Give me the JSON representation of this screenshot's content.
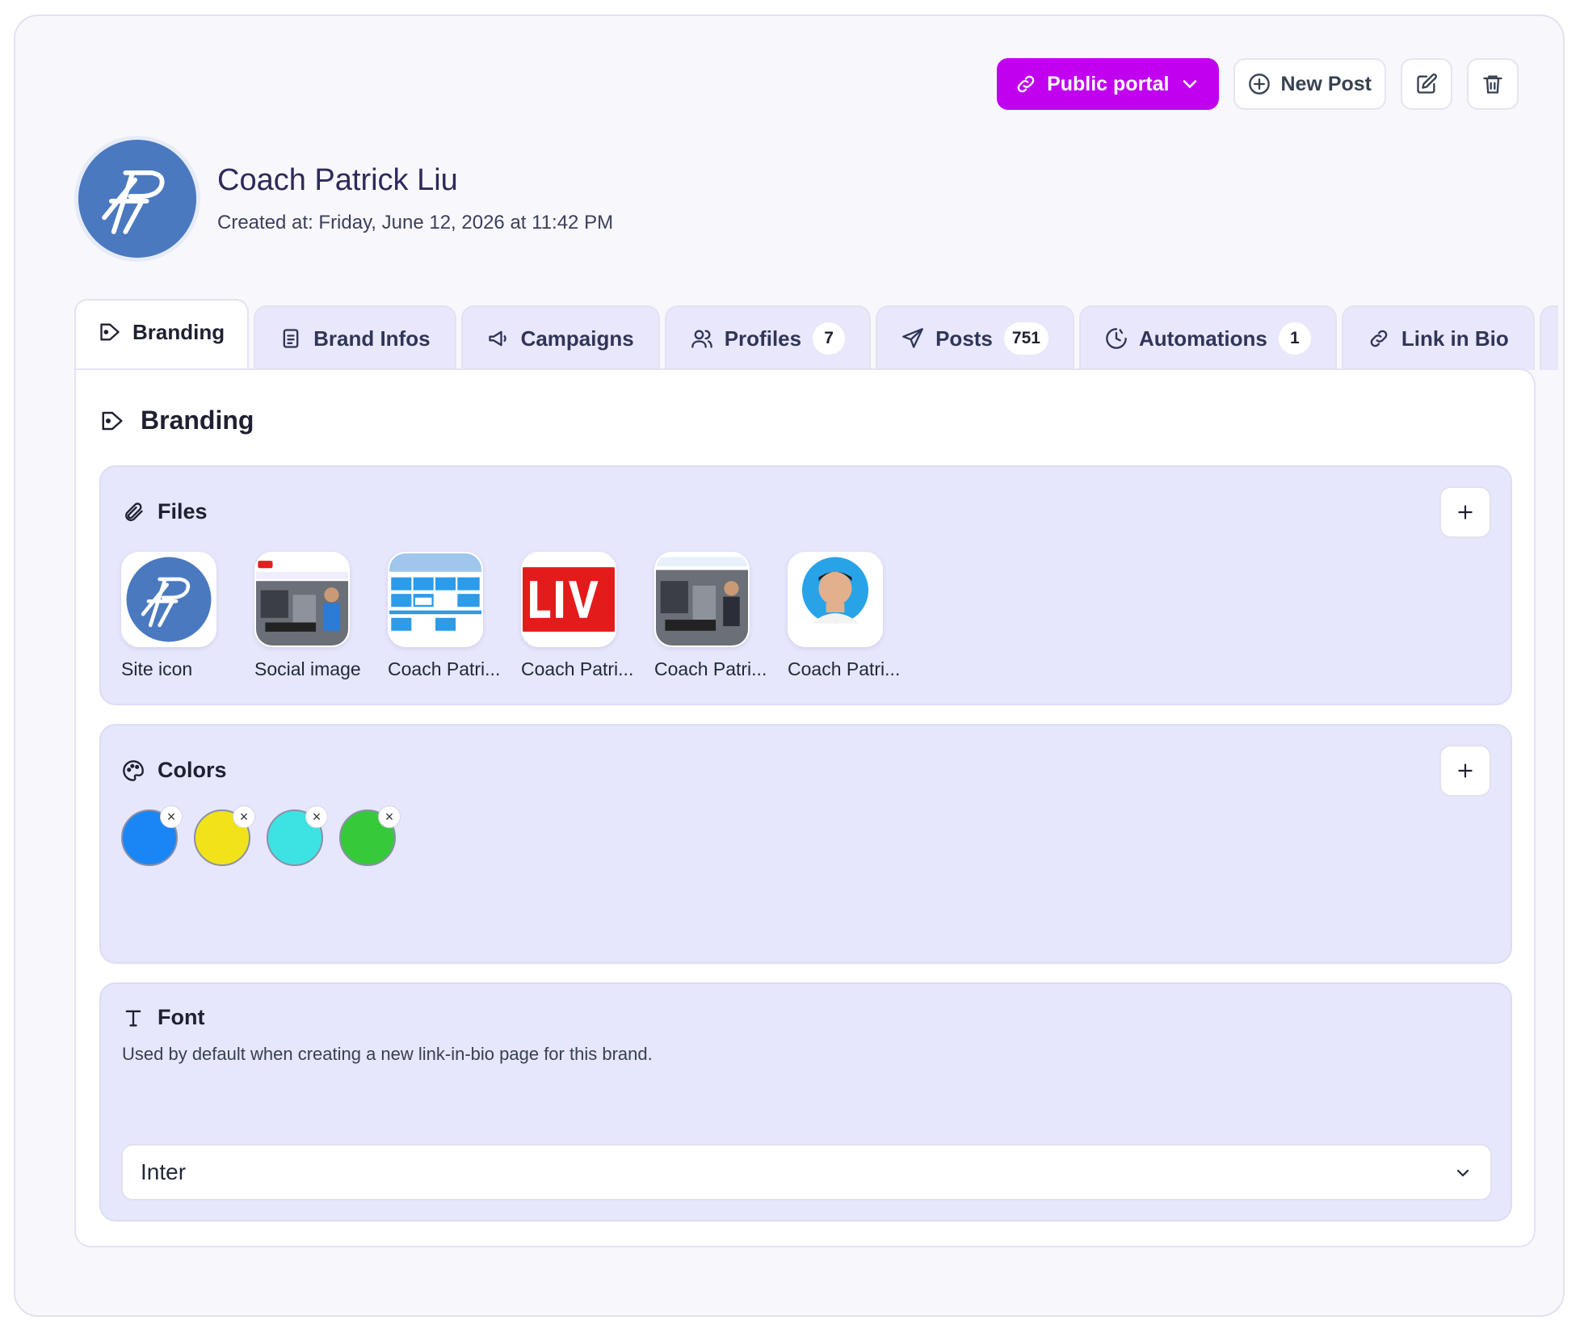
{
  "header": {
    "public_portal_label": "Public portal",
    "new_post_label": "New Post"
  },
  "profile": {
    "name": "Coach Patrick Liu",
    "created_at": "Created at: Friday, June 12, 2026 at 11:42 PM"
  },
  "tabs": [
    {
      "label": "Branding",
      "icon": "tag-icon",
      "active": true
    },
    {
      "label": "Brand Infos",
      "icon": "document-icon"
    },
    {
      "label": "Campaigns",
      "icon": "megaphone-icon"
    },
    {
      "label": "Profiles",
      "icon": "users-icon",
      "count": "7"
    },
    {
      "label": "Posts",
      "icon": "send-icon",
      "count": "751"
    },
    {
      "label": "Automations",
      "icon": "clock-icon",
      "count": "1"
    },
    {
      "label": "Link in Bio",
      "icon": "link-icon"
    },
    {
      "label": "",
      "icon": "lightning-icon"
    }
  ],
  "branding": {
    "title": "Branding",
    "files": {
      "title": "Files",
      "items": [
        {
          "label": "Site icon",
          "thumb": "logo"
        },
        {
          "label": "Social image",
          "thumb": "gym"
        },
        {
          "label": "Coach Patri...",
          "thumb": "schedule"
        },
        {
          "label": "Coach Patri...",
          "thumb": "live"
        },
        {
          "label": "Coach Patri...",
          "thumb": "gym"
        },
        {
          "label": "Coach Patri...",
          "thumb": "portrait"
        }
      ]
    },
    "colors": {
      "title": "Colors",
      "swatches": [
        "#1a86f5",
        "#f2e21a",
        "#3de3e3",
        "#36c93a"
      ]
    },
    "font": {
      "title": "Font",
      "description": "Used by default when creating a new link-in-bio page for this brand.",
      "selected": "Inter"
    }
  },
  "colors": {
    "accent": "#c100f0",
    "tab_bg": "#e8e7fb",
    "panel_bg": "#e6e6fc"
  }
}
